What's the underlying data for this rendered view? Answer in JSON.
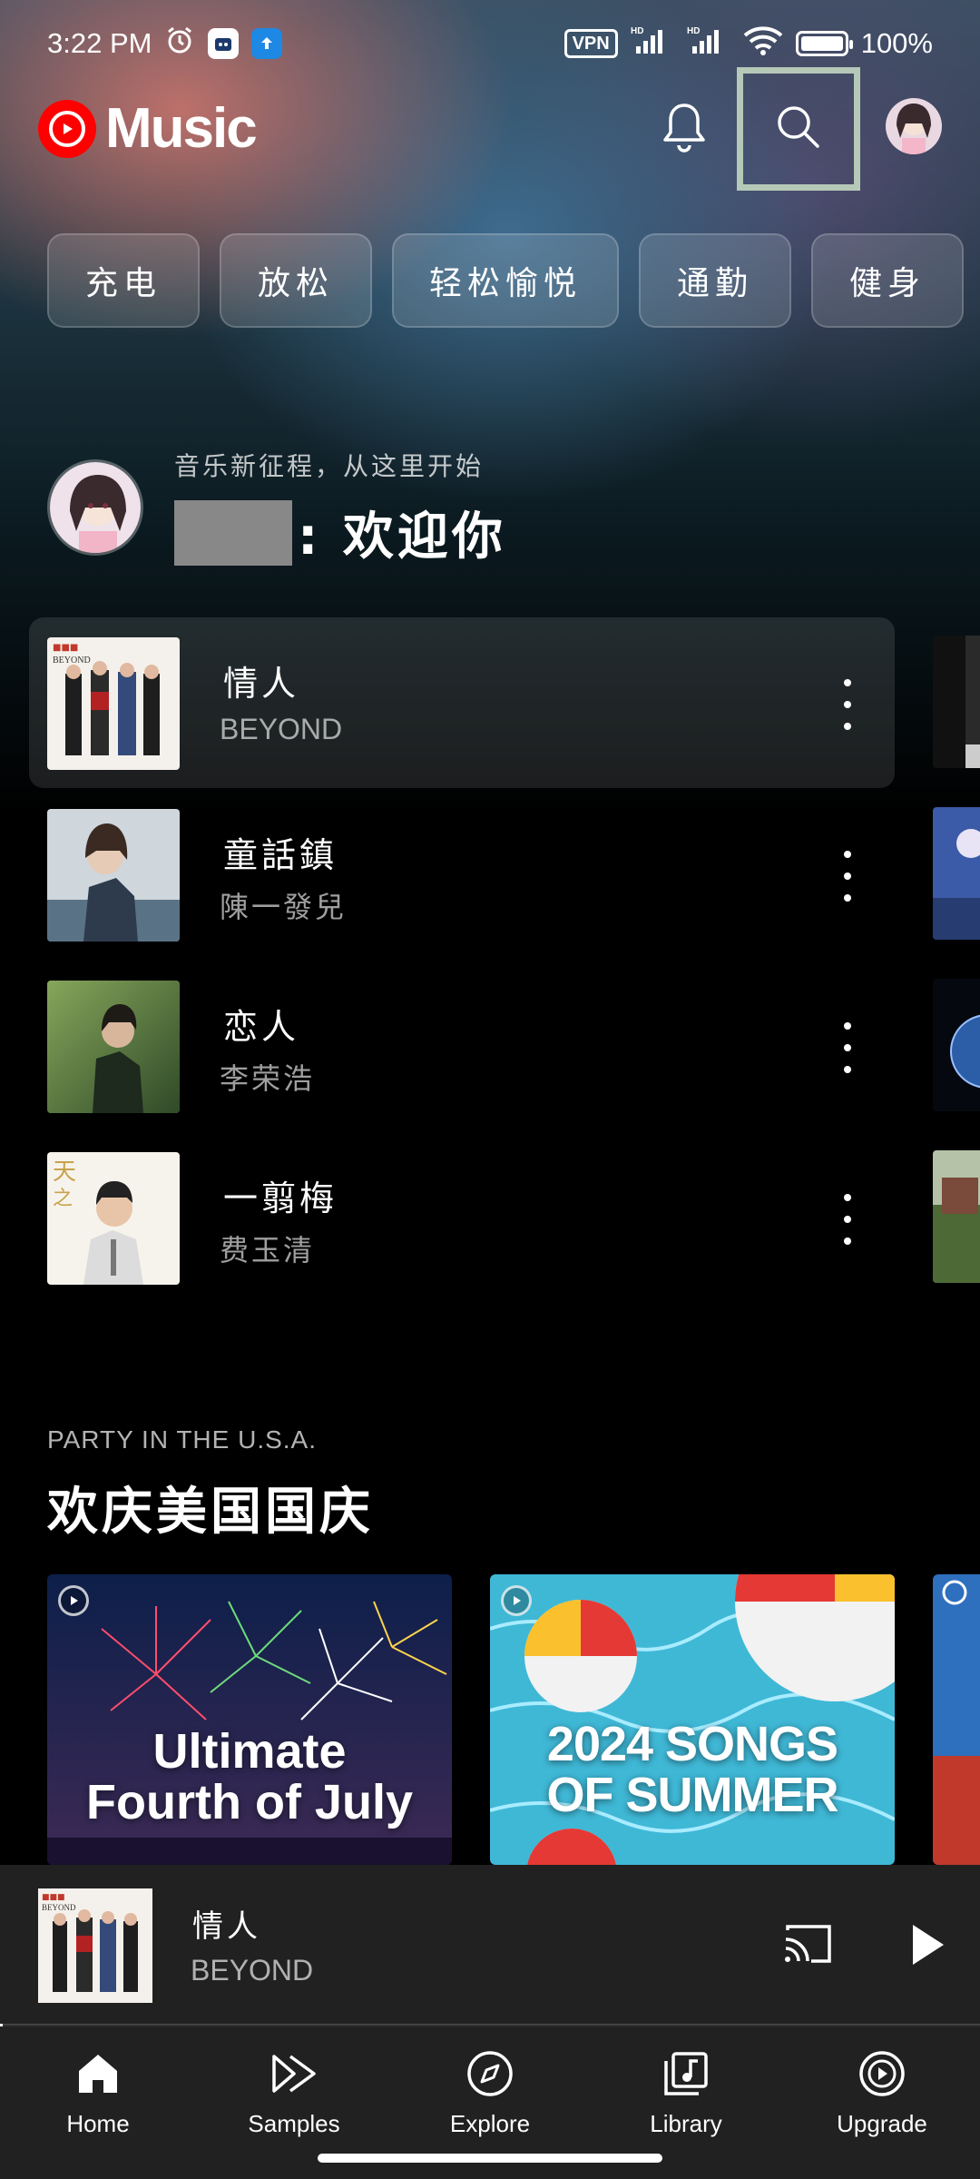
{
  "status_bar": {
    "time": "3:22 PM",
    "vpn": "VPN",
    "battery": "100%"
  },
  "header": {
    "logo_text": "Music",
    "brand_color": "#ff0000"
  },
  "chips": [
    "充电",
    "放松",
    "轻松愉悦",
    "通勤",
    "健身"
  ],
  "welcome": {
    "subtitle": "音乐新征程，从这里开始",
    "title": ": 欢迎你"
  },
  "songs": [
    {
      "title": "情人",
      "artist": "BEYOND"
    },
    {
      "title": "童話鎮",
      "artist": "陳一發兒"
    },
    {
      "title": "恋人",
      "artist": "李荣浩"
    },
    {
      "title": "一翦梅",
      "artist": "费玉清"
    }
  ],
  "section": {
    "eyebrow": "PARTY IN THE U.S.A.",
    "title": "欢庆美国国庆",
    "cards": [
      {
        "line1": "Ultimate",
        "line2": "Fourth of July"
      },
      {
        "line1": "2024 SONGS",
        "line2": "OF SUMMER"
      }
    ]
  },
  "mini_player": {
    "title": "情人",
    "artist": "BEYOND",
    "progress": 0.003
  },
  "nav": [
    {
      "label": "Home",
      "icon": "home-icon"
    },
    {
      "label": "Samples",
      "icon": "samples-icon"
    },
    {
      "label": "Explore",
      "icon": "explore-icon"
    },
    {
      "label": "Library",
      "icon": "library-icon"
    },
    {
      "label": "Upgrade",
      "icon": "upgrade-icon"
    }
  ]
}
